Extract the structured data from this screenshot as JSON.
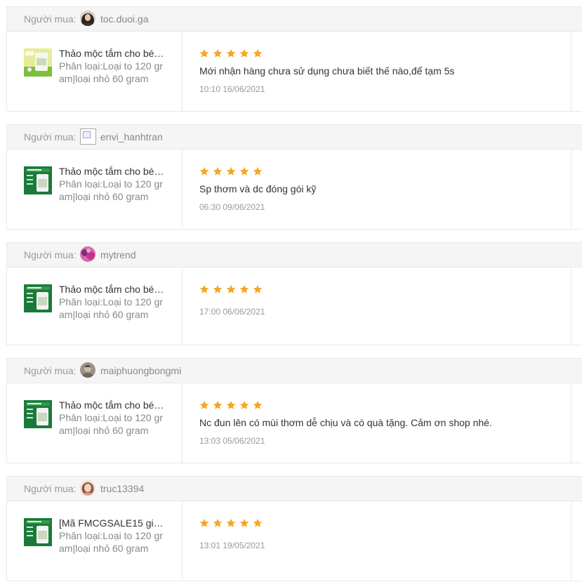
{
  "buyer_label": "Người mua:",
  "star_color": "#f5a623",
  "reviews": [
    {
      "username": "toc.duoi.ga",
      "avatar": "person-dark",
      "product_name": "Thảo mộc tắm cho bé…",
      "variant_line1": "Phân loại:Loại to 120 gr",
      "variant_line2": "am|loại nhỏ 60 gram",
      "thumb": "light-green",
      "rating": 5,
      "comment": "Mới nhận hàng chưa sử dụng chưa biết thế nào,để tạm 5s",
      "time": "10:10 16/06/2021"
    },
    {
      "username": "envi_hanhtran",
      "avatar": "broken",
      "product_name": "Thảo mộc tắm cho bé…",
      "variant_line1": "Phân loại:Loại to 120 gr",
      "variant_line2": "am|loại nhỏ 60 gram",
      "thumb": "dark-green",
      "rating": 5,
      "comment": "Sp thơm và dc đóng gói kỹ",
      "time": "06:30 09/06/2021"
    },
    {
      "username": "mytrend",
      "avatar": "pink-purple",
      "product_name": "Thảo mộc tắm cho bé…",
      "variant_line1": "Phân loại:Loại to 120 gr",
      "variant_line2": "am|loại nhỏ 60 gram",
      "thumb": "dark-green",
      "rating": 5,
      "comment": "",
      "time": "17:00 06/06/2021"
    },
    {
      "username": "maiphuongbongmi",
      "avatar": "gray-photo",
      "product_name": "Thảo mộc tắm cho bé…",
      "variant_line1": "Phân loại:Loại to 120 gr",
      "variant_line2": "am|loại nhỏ 60 gram",
      "thumb": "dark-green",
      "rating": 5,
      "comment": "Nc đun lên có mùi thơm dễ chịu và có quà tặng. Cảm ơn shop nhé.",
      "time": "13:03 05/06/2021"
    },
    {
      "username": "truc13394",
      "avatar": "person-light",
      "product_name": "[Mã FMCGSALE15 gi…",
      "variant_line1": "Phân loại:Loại to 120 gr",
      "variant_line2": "am|loại nhỏ 60 gram",
      "thumb": "dark-green",
      "rating": 5,
      "comment": "",
      "time": "13:01 19/05/2021"
    }
  ]
}
